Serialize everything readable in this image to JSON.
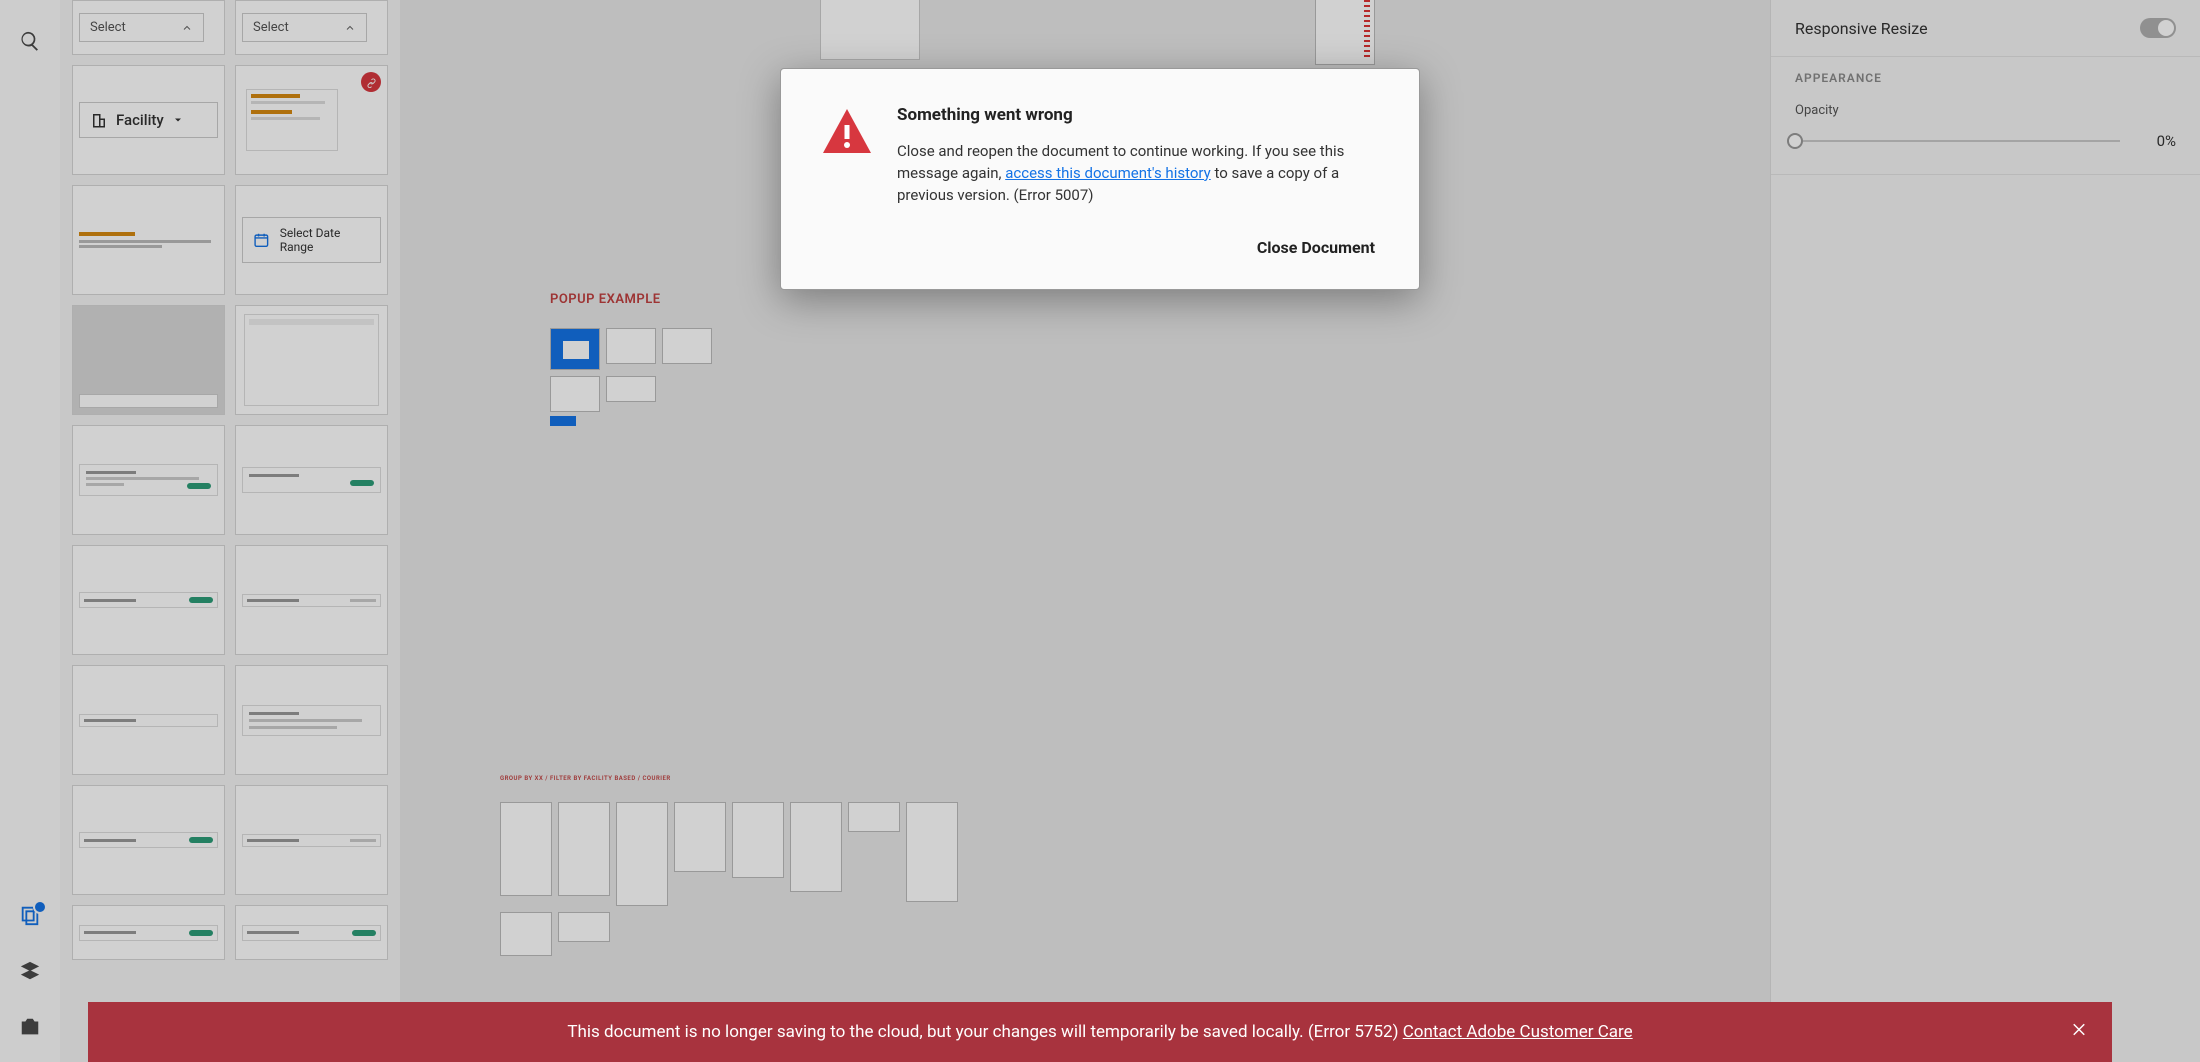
{
  "modal": {
    "title": "Something went wrong",
    "text_before_link": "Close and reopen the document to continue working. If you see this message again, ",
    "link_text": "access this document's history",
    "text_after_link": " to save a copy of a previous version. (Error 5007)",
    "close_button": "Close Document"
  },
  "banner": {
    "text_before_link": "This document is no longer saving to the cloud, but your changes will temporarily be saved locally. (Error 5752) ",
    "link_text": "Contact Adobe Customer Care"
  },
  "props": {
    "responsive_resize_label": "Responsive Resize",
    "appearance_label": "APPEARANCE",
    "opacity_label": "Opacity",
    "opacity_value": "0%"
  },
  "thumbs": {
    "select_label": "Select",
    "facility_label": "Facility",
    "date_range_label": "Select Date Range"
  },
  "canvas": {
    "popup_label": "POPUP EXAMPLE",
    "section2_label": "GROUP BY XX / FILTER BY FACILITY BASED / COURIER"
  }
}
